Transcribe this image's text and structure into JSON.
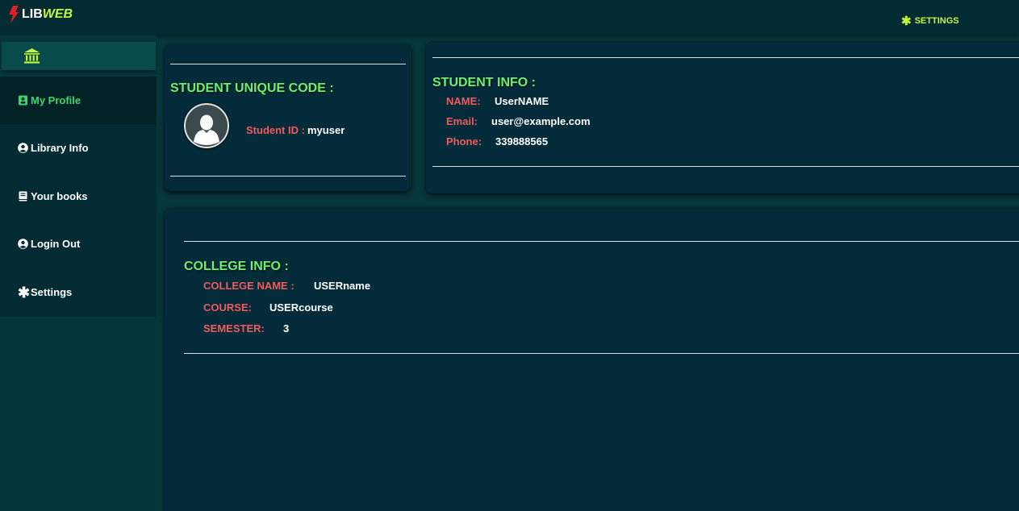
{
  "brand": {
    "part1": "LIB",
    "part2": "WEB"
  },
  "topbar": {
    "settings_label": "SETTINGS"
  },
  "sidebar": {
    "items": [
      {
        "label": "My Profile",
        "icon": "id-card-icon",
        "active": true
      },
      {
        "label": "Library Info",
        "icon": "user-circle-icon",
        "active": false
      },
      {
        "label": "Your books",
        "icon": "book-icon",
        "active": false
      },
      {
        "label": "Login Out",
        "icon": "user-circle-icon",
        "active": false
      },
      {
        "label": "Settings",
        "icon": "asterisk-icon",
        "active": false
      }
    ]
  },
  "unique_card": {
    "heading": "STUDENT UNIQUE CODE :",
    "student_id_label": "Student ID :",
    "student_id_value": "myuser"
  },
  "student_info": {
    "heading": "STUDENT INFO :",
    "name_label": "NAME:",
    "name_value": "UserNAME",
    "email_label": "Email:",
    "email_value": "user@example.com",
    "phone_label": "Phone:",
    "phone_value": "339888565"
  },
  "college_info": {
    "heading": "COLLEGE INFO :",
    "college_label": "COLLEGE NAME :",
    "college_value": "USERname",
    "course_label": "COURSE:",
    "course_value": "USERcourse",
    "semester_label": "SEMESTER:",
    "semester_value": "3"
  },
  "colors": {
    "accent_green": "#6ef06e",
    "lime": "#c3f73a",
    "label_red": "#f05b5b",
    "active_green": "#38d96b",
    "panel": "#032b3a"
  }
}
